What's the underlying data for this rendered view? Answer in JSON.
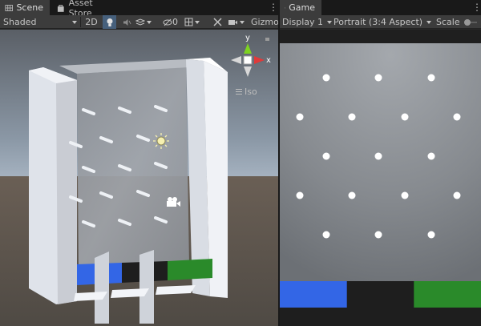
{
  "scene_panel": {
    "tabs": [
      {
        "label": "Scene",
        "icon": "grid-icon",
        "active": true
      },
      {
        "label": "Asset Store",
        "icon": "store-bag-icon",
        "active": false
      }
    ],
    "toolbar": {
      "shading_mode": "Shaded",
      "mode_2d_label": "2D",
      "effects_count": "0",
      "gizmos_label": "Gizmos",
      "icons": [
        "lightbulb-icon",
        "audio-icon",
        "effects-icon",
        "visibility-icon",
        "tools-icon",
        "camera-icon"
      ]
    },
    "gizmo": {
      "x_label": "x",
      "y_label": "y",
      "projection_label": "Iso"
    },
    "scene_objects": {
      "colors": {
        "blue": "#3366e6",
        "dark": "#1e1e1e",
        "green": "#2a8a2a"
      }
    }
  },
  "game_panel": {
    "tabs": [
      {
        "label": "Game",
        "icon": "gamepad-icon",
        "active": true
      }
    ],
    "toolbar": {
      "display": "Display 1",
      "aspect": "Portrait (3:4 Aspect)",
      "scale_label": "Scale"
    },
    "pegs": {
      "rows": [
        3,
        4,
        3,
        4,
        3
      ]
    },
    "bins": [
      {
        "color": "#3366e6",
        "name": "blue"
      },
      {
        "color": "#1e1e1e",
        "name": "dark"
      },
      {
        "color": "#2a8a2a",
        "name": "green"
      }
    ]
  }
}
